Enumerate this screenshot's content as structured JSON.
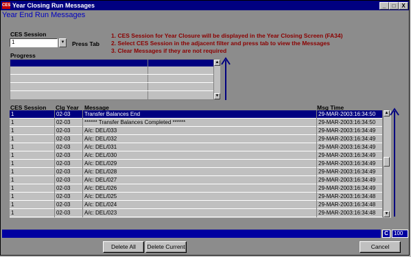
{
  "window": {
    "title": "Year Closing Run Messages",
    "app_icon": "CES",
    "subtitle": "Year End Run Messages",
    "min_label": "_",
    "max_label": "□",
    "close_label": "X"
  },
  "filter": {
    "ces_session_label": "CES Session",
    "ces_session_value": "1",
    "lov_label": "▾",
    "press_tab_label": "Press Tab"
  },
  "instructions": [
    "1. CES Session for Year Closure will be displayed in the Year Closing Screen (FA34)",
    "2. Select CES Session in the adjacent filter and press tab to view the Messages",
    "3. Clear Messages if they are not required"
  ],
  "progress": {
    "label": "Progress"
  },
  "messages": {
    "columns": [
      "CES Session",
      "Clg Year",
      "Message",
      "Msg Time"
    ],
    "rows": [
      [
        "1",
        "02-03",
        "Transfer Balances End",
        "29-MAR-2003:16:34:50"
      ],
      [
        "1",
        "02-03",
        "****** Transfer Balances Completed ******",
        "29-MAR-2003:16:34:50"
      ],
      [
        "1",
        "02-03",
        "A/c: DEL/033",
        "29-MAR-2003:16:34:49"
      ],
      [
        "1",
        "02-03",
        "A/c: DEL/032",
        "29-MAR-2003:16:34:49"
      ],
      [
        "1",
        "02-03",
        "A/c: DEL/031",
        "29-MAR-2003:16:34:49"
      ],
      [
        "1",
        "02-03",
        "A/c: DEL/030",
        "29-MAR-2003:16:34:49"
      ],
      [
        "1",
        "02-03",
        "A/c: DEL/029",
        "29-MAR-2003:16:34:49"
      ],
      [
        "1",
        "02-03",
        "A/c: DEL/028",
        "29-MAR-2003:16:34:49"
      ],
      [
        "1",
        "02-03",
        "A/c: DEL/027",
        "29-MAR-2003:16:34:49"
      ],
      [
        "1",
        "02-03",
        "A/c: DEL/026",
        "29-MAR-2003:16:34:49"
      ],
      [
        "1",
        "02-03",
        "A/c: DEL/025",
        "29-MAR-2003:16:34:48"
      ],
      [
        "1",
        "02-03",
        "A/c: DEL/024",
        "29-MAR-2003:16:34:48"
      ],
      [
        "1",
        "02-03",
        "A/c: DEL/023",
        "29-MAR-2003:16:34:48"
      ]
    ],
    "selected_row": 0
  },
  "status": {
    "mode": "C",
    "count": "100"
  },
  "buttons": {
    "delete_all": "Delete All",
    "delete_current": "Delete Current",
    "cancel": "Cancel"
  },
  "colors": {
    "title_bar": "#000080",
    "selection": "#000080",
    "instructions": "#8b0000",
    "subtitle": "#0000c0",
    "annotation_arrow": "#000080"
  },
  "scroll_up_icon": "▲",
  "scroll_down_icon": "▼"
}
